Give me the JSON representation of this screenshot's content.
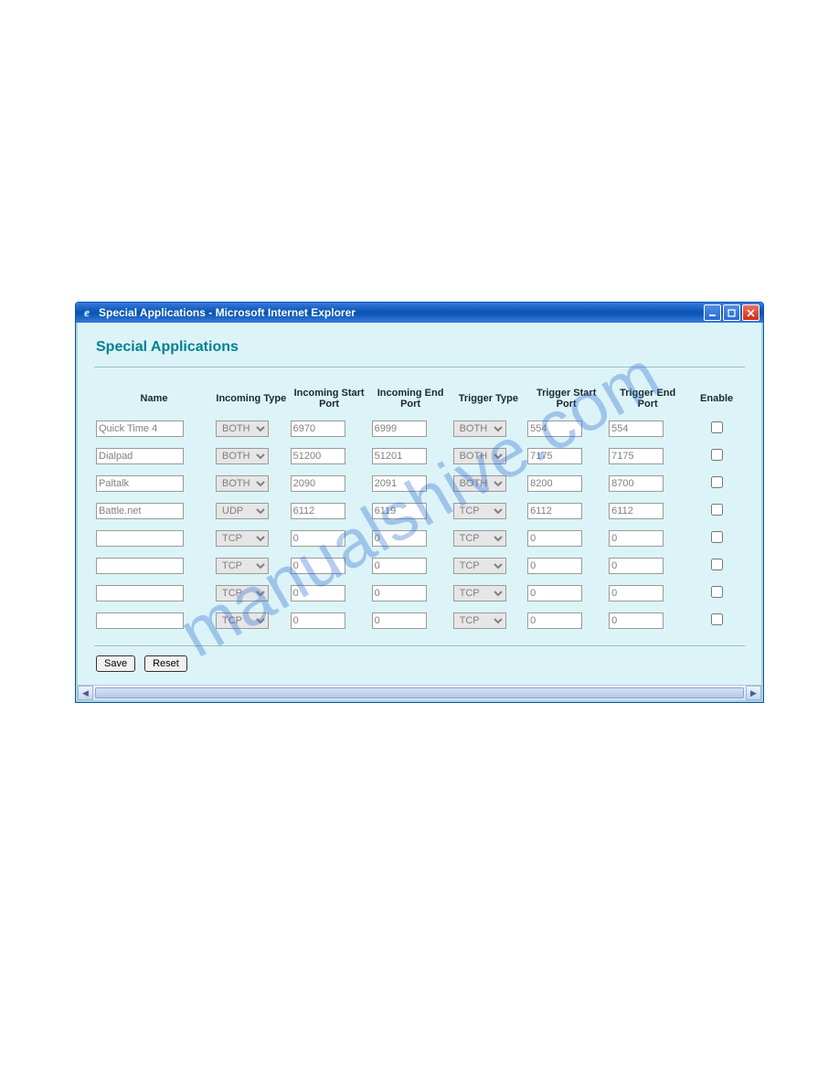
{
  "window": {
    "title": "Special Applications - Microsoft Internet Explorer"
  },
  "page": {
    "title": "Special Applications"
  },
  "watermark": "manualshive.com",
  "columns": {
    "name": "Name",
    "incoming_type": "Incoming Type",
    "incoming_start": "Incoming Start Port",
    "incoming_end": "Incoming End Port",
    "trigger_type": "Trigger Type",
    "trigger_start": "Trigger Start Port",
    "trigger_end": "Trigger End Port",
    "enable": "Enable"
  },
  "type_options": [
    "BOTH",
    "TCP",
    "UDP"
  ],
  "rows": [
    {
      "name": "Quick Time 4",
      "in_type": "BOTH",
      "in_start": "6970",
      "in_end": "6999",
      "tr_type": "BOTH",
      "tr_start": "554",
      "tr_end": "554",
      "enable": false
    },
    {
      "name": "Dialpad",
      "in_type": "BOTH",
      "in_start": "51200",
      "in_end": "51201",
      "tr_type": "BOTH",
      "tr_start": "7175",
      "tr_end": "7175",
      "enable": false
    },
    {
      "name": "Paltalk",
      "in_type": "BOTH",
      "in_start": "2090",
      "in_end": "2091",
      "tr_type": "BOTH",
      "tr_start": "8200",
      "tr_end": "8700",
      "enable": false
    },
    {
      "name": "Battle.net",
      "in_type": "UDP",
      "in_start": "6112",
      "in_end": "6119",
      "tr_type": "TCP",
      "tr_start": "6112",
      "tr_end": "6112",
      "enable": false
    },
    {
      "name": "",
      "in_type": "TCP",
      "in_start": "0",
      "in_end": "0",
      "tr_type": "TCP",
      "tr_start": "0",
      "tr_end": "0",
      "enable": false
    },
    {
      "name": "",
      "in_type": "TCP",
      "in_start": "0",
      "in_end": "0",
      "tr_type": "TCP",
      "tr_start": "0",
      "tr_end": "0",
      "enable": false
    },
    {
      "name": "",
      "in_type": "TCP",
      "in_start": "0",
      "in_end": "0",
      "tr_type": "TCP",
      "tr_start": "0",
      "tr_end": "0",
      "enable": false
    },
    {
      "name": "",
      "in_type": "TCP",
      "in_start": "0",
      "in_end": "0",
      "tr_type": "TCP",
      "tr_start": "0",
      "tr_end": "0",
      "enable": false
    }
  ],
  "buttons": {
    "save": "Save",
    "reset": "Reset"
  }
}
